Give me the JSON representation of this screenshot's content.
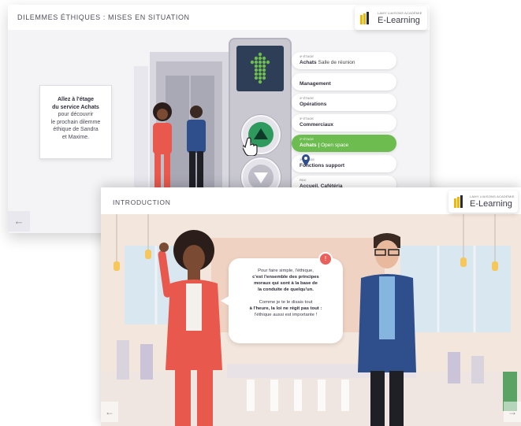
{
  "back_slide": {
    "title": "DILEMMES ÉTHIQUES : MISES EN SITUATION",
    "logo": {
      "small": "LAMY LIAISONS ACADÉMIE",
      "main": "E-Learning"
    },
    "instruction": {
      "line1": "Allez à l'étage",
      "line2": "du service Achats",
      "line3": "pour découvrir",
      "line4": "le prochain dilemme",
      "line5": "éthique de Sandra",
      "line6": "et Maxime."
    },
    "floors": [
      {
        "level": "4ᵉ ÉTAGE",
        "dept": "Achats",
        "sub": "Salle de réunion",
        "active": false
      },
      {
        "level": "",
        "dept": "Management",
        "sub": "",
        "active": false
      },
      {
        "level": "4ᵉ ÉTAGE",
        "dept": "Opérations",
        "sub": "",
        "active": false
      },
      {
        "level": "3ᵉ ÉTAGE",
        "dept": "Commerciaux",
        "sub": "",
        "active": false
      },
      {
        "level": "2ᵉ ÉTAGE",
        "dept": "Achats",
        "sub": "Open space",
        "active": true
      },
      {
        "level": "1ᵉʳ ÉTAGE",
        "dept": "Fonctions support",
        "sub": "",
        "active": false
      },
      {
        "level": "RDC",
        "dept": "Accueil, Cafétéria",
        "sub": "",
        "active": false
      }
    ],
    "prev_arrow": "←",
    "colors": {
      "accent": "#6cbc4f",
      "up_button": "#2e9a5e"
    }
  },
  "front_slide": {
    "title": "INTRODUCTION",
    "logo": {
      "small": "LAMY LIAISONS ACADÉMIE",
      "main": "E-Learning"
    },
    "bubble": {
      "l1": "Pour faire simple, l'éthique,",
      "l2": "c'est l'ensemble des principes",
      "l3": "moraux qui sont à la base de",
      "l4": "la conduite de quelqu'un.",
      "l5": "Comme je te le disais tout",
      "l6": "à l'heure, la loi ne régit pas tout :",
      "l7": "l'éthique aussi est importante !"
    },
    "prev_arrow": "←",
    "next_arrow": "→"
  }
}
